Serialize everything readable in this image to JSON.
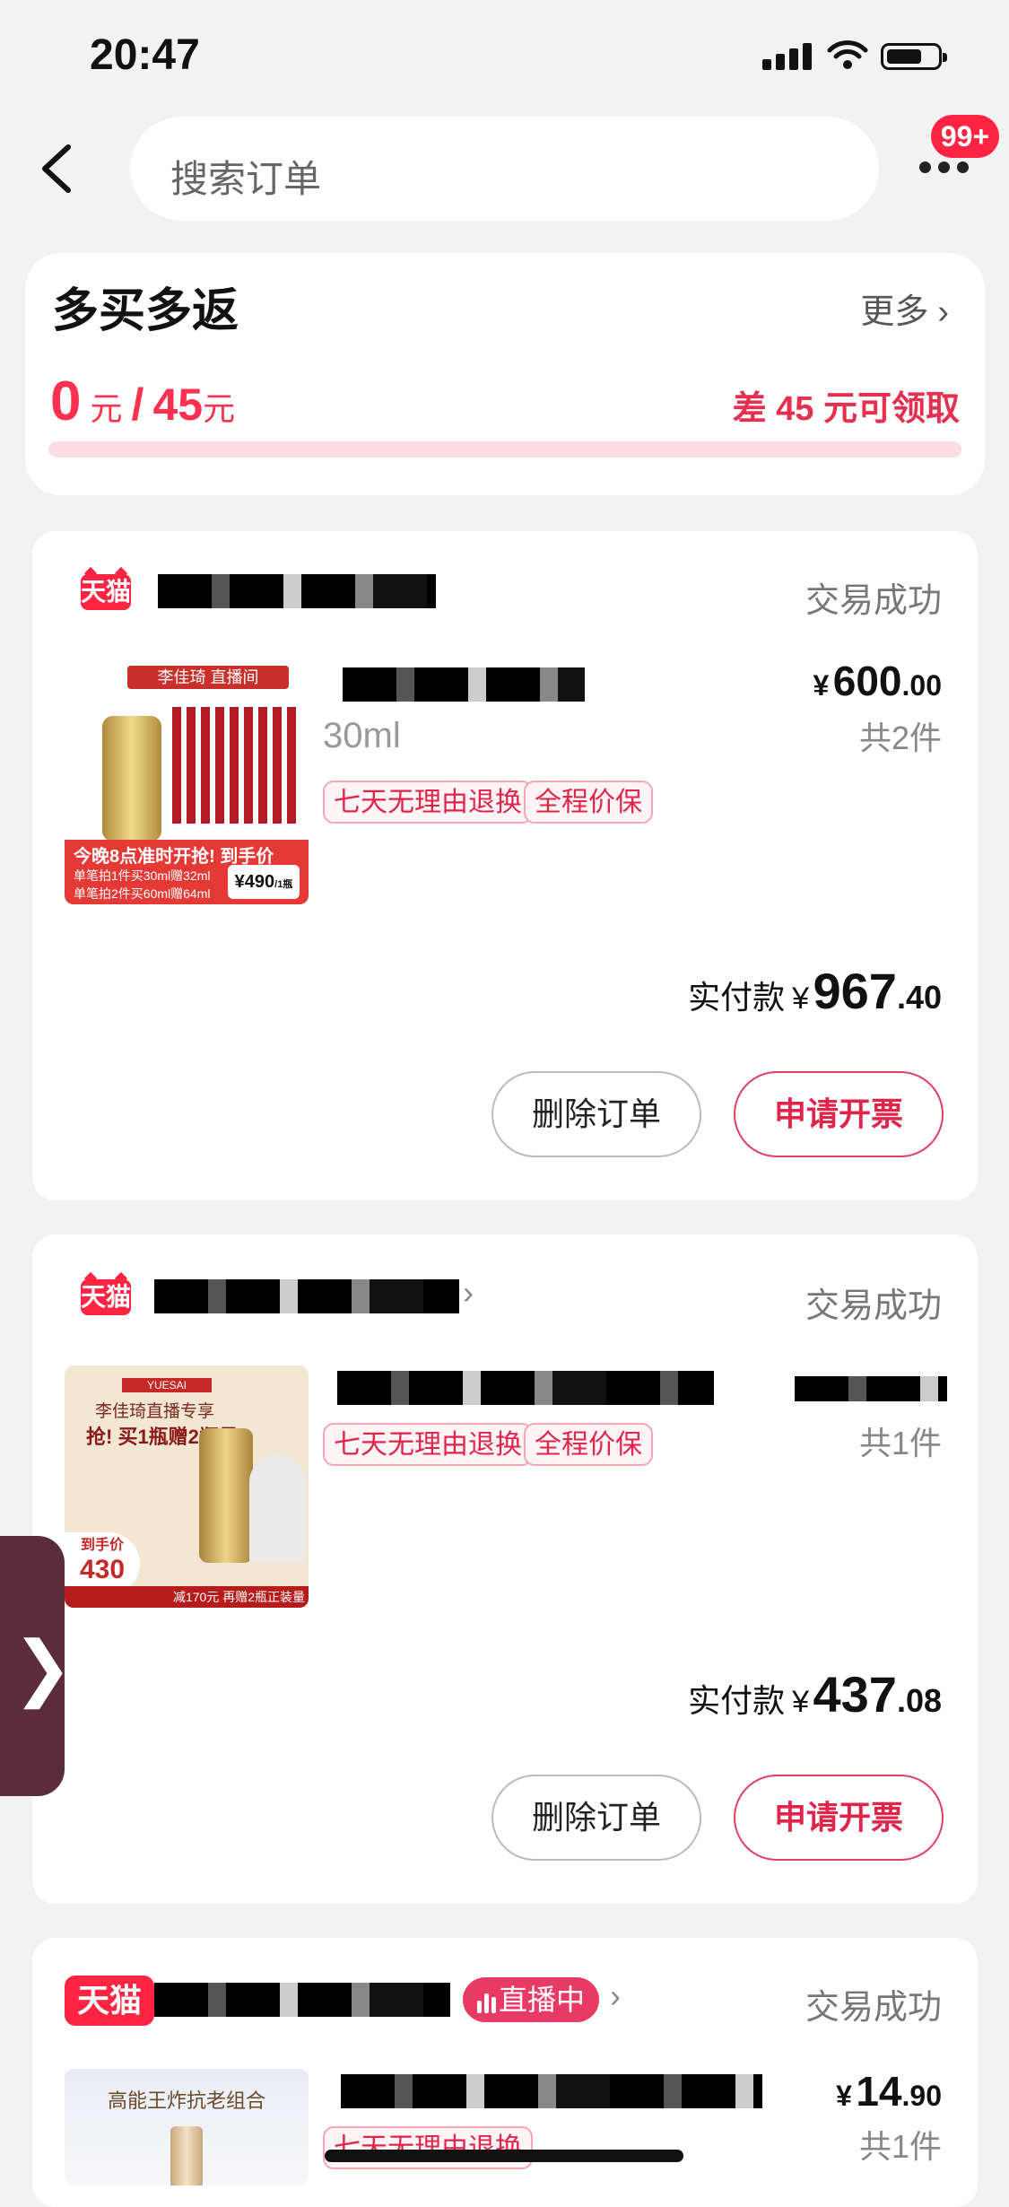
{
  "status_bar": {
    "time": "20:47"
  },
  "header": {
    "search_placeholder": "搜索订单",
    "notification_badge": "99+"
  },
  "promo": {
    "title": "多买多返",
    "more_label": "更多",
    "current_amount": "0",
    "unit": "元",
    "separator": "/",
    "target_amount": "45",
    "difference_text": "差 45 元可领取",
    "progress_fraction": 0.0
  },
  "orders": [
    {
      "store_badge": "天猫",
      "status": "交易成功",
      "product_volume": "30ml",
      "tags": [
        "七天无理由退换",
        "全程价保"
      ],
      "price": {
        "currency": "¥",
        "integer": "600",
        "decimal": ".00"
      },
      "quantity": "共2件",
      "paid_label": "实付款",
      "paid": {
        "currency": "¥",
        "integer": "967",
        "decimal": ".40"
      },
      "buttons": {
        "delete": "删除订单",
        "invoice": "申请开票"
      },
      "thumb": {
        "anchor": "李佳琦",
        "live": "直播间",
        "headline": "今晚8点准时开抢! 到手价",
        "line1": "单笔拍1件买30ml赠32ml",
        "line2": "单笔拍2件买60ml赠64ml",
        "price": "¥490",
        "unit": "/1瓶"
      }
    },
    {
      "store_badge": "天猫",
      "status": "交易成功",
      "tags": [
        "七天无理由退换",
        "全程价保"
      ],
      "quantity": "共1件",
      "paid_label": "实付款",
      "paid": {
        "currency": "¥",
        "integer": "437",
        "decimal": ".08"
      },
      "buttons": {
        "delete": "删除订单",
        "invoice": "申请开票"
      },
      "thumb": {
        "brand": "YUESAI",
        "title": "李佳琦直播专享",
        "headline": "抢! 买1瓶赠2瓶量",
        "price_label": "到手价",
        "price": "430",
        "bottom": "减170元 再赠2瓶正装量"
      }
    },
    {
      "store_badge": "天猫",
      "live_label": "直播中",
      "status": "交易成功",
      "tags": [
        "七天无理由退换"
      ],
      "price": {
        "currency": "¥",
        "integer": "14",
        "decimal": ".90"
      },
      "quantity": "共1件",
      "thumb": {
        "title": "高能王炸抗老组合"
      }
    }
  ],
  "side_handle": {
    "glyph": "❯"
  },
  "colors": {
    "accent": "#ff2442",
    "tag_border": "#f4a6b4",
    "background": "#f2f2f2"
  }
}
